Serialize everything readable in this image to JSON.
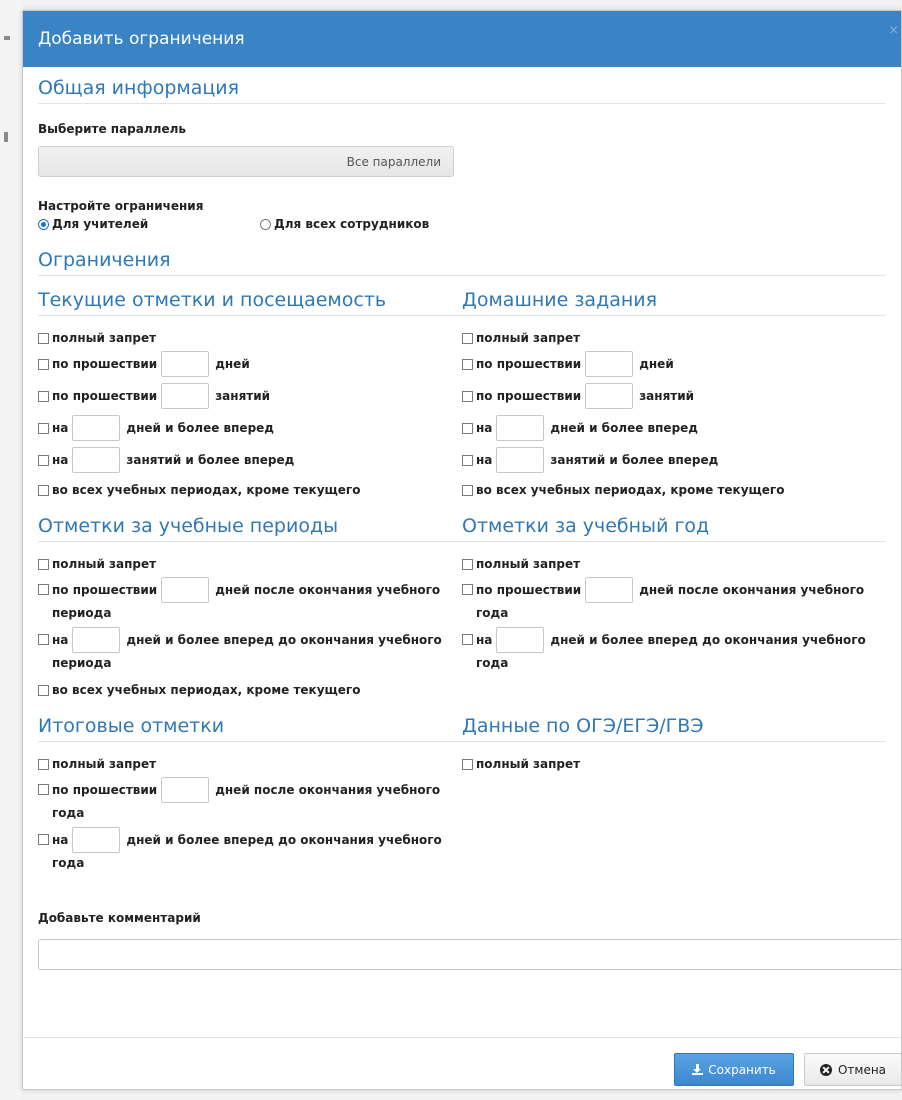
{
  "dialog": {
    "title": "Добавить ограничения",
    "close_label": "×"
  },
  "general": {
    "title": "Общая информация",
    "parallel_label": "Выберите параллель",
    "parallel_value": "Все параллели",
    "restrictions_setup_label": "Настройте ограничения",
    "radio_teachers": "Для учителей",
    "radio_all_staff": "Для всех сотрудников",
    "radio_selected": "teachers"
  },
  "restrictions_title": "Ограничения",
  "current_marks": {
    "title": "Текущие отметки и посещаемость",
    "full_ban": "полный запрет",
    "after_prefix": "по прошествии",
    "after_days_suffix": "дней",
    "after_lessons_suffix": "занятий",
    "ahead_prefix": "на",
    "ahead_days_suffix": "дней и более вперед",
    "ahead_lessons_suffix": "занятий и более вперед",
    "all_periods": "во всех учебных периодах, кроме текущего"
  },
  "homework": {
    "title": "Домашние задания",
    "full_ban": "полный запрет",
    "after_prefix": "по прошествии",
    "after_days_suffix": "дней",
    "after_lessons_suffix": "занятий",
    "ahead_prefix": "на",
    "ahead_days_suffix": "дней и более вперед",
    "ahead_lessons_suffix": "занятий и более вперед",
    "all_periods": "во всех учебных периодах, кроме текущего"
  },
  "period_marks": {
    "title": "Отметки за учебные периоды",
    "full_ban": "полный запрет",
    "after_prefix": "по прошествии",
    "after_suffix": "дней после окончания учебного",
    "after_cont": "периода",
    "ahead_prefix": "на",
    "ahead_suffix": "дней и более вперед до окончания учебного",
    "ahead_cont": "периода",
    "all_periods": "во всех учебных периодах, кроме текущего"
  },
  "year_marks": {
    "title": "Отметки за учебный год",
    "full_ban": "полный запрет",
    "after_prefix": "по прошествии",
    "after_suffix": "дней после окончания учебного",
    "after_cont": "года",
    "ahead_prefix": "на",
    "ahead_suffix": "дней и более вперед до окончания учебного",
    "ahead_cont": "года"
  },
  "final_marks": {
    "title": "Итоговые отметки",
    "full_ban": "полный запрет",
    "after_prefix": "по прошествии",
    "after_suffix": "дней после окончания учебного",
    "after_cont": "года",
    "ahead_prefix": "на",
    "ahead_suffix": "дней и более вперед до окончания учебного",
    "ahead_cont": "года"
  },
  "exam_data": {
    "title": "Данные по ОГЭ/ЕГЭ/ГВЭ",
    "full_ban": "полный запрет"
  },
  "comment": {
    "label": "Добавьте комментарий",
    "value": ""
  },
  "footer": {
    "save_label": "Сохранить",
    "cancel_label": "Отмена"
  },
  "colors": {
    "header_bg": "#3a84c5",
    "section_title": "#2f78b7",
    "save_button": "#3c87cf"
  }
}
